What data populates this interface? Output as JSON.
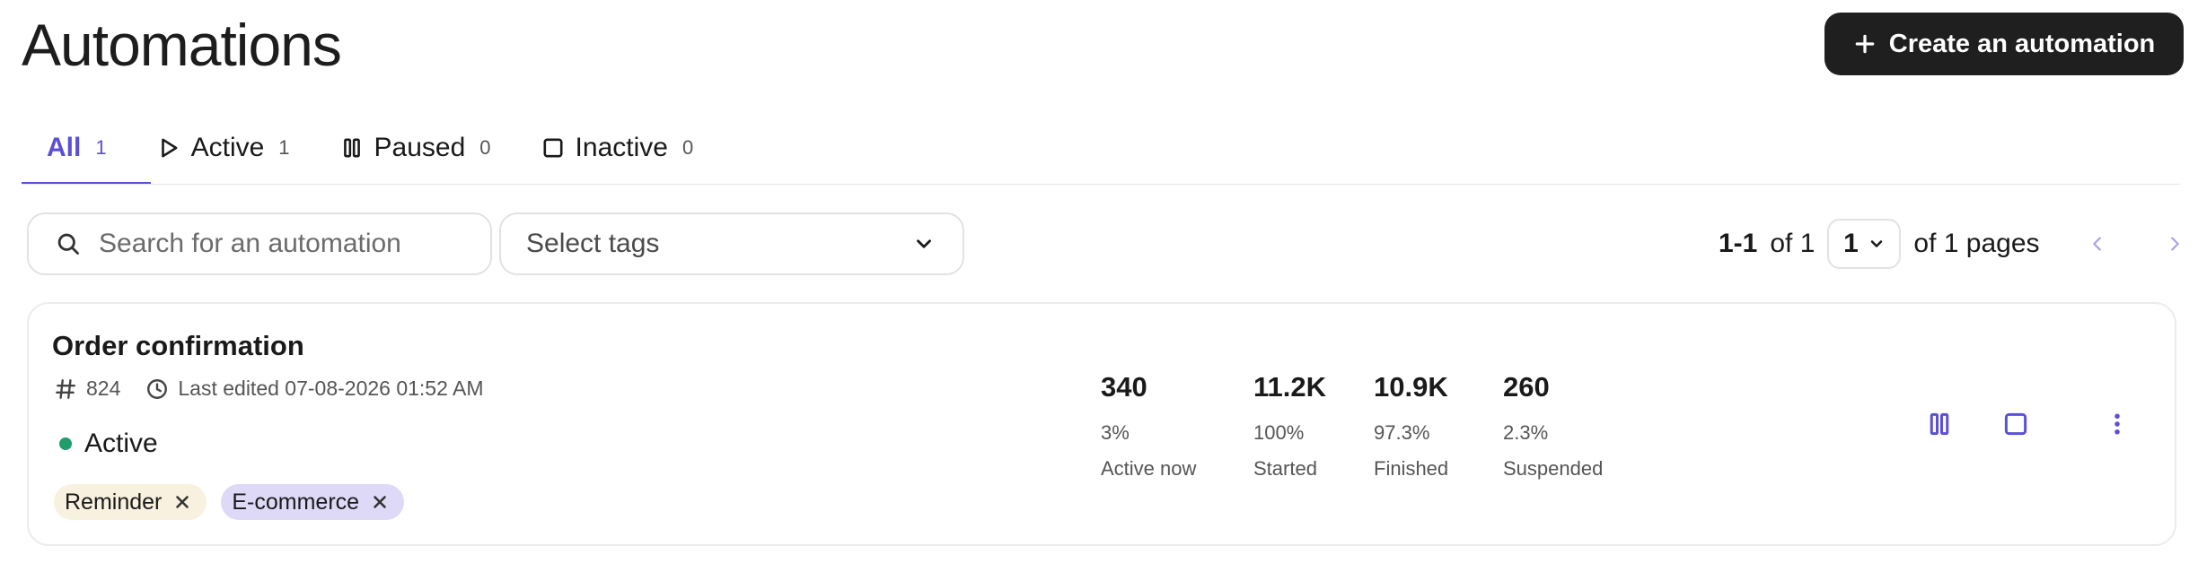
{
  "header": {
    "title": "Automations",
    "create_label": "Create an automation"
  },
  "tabs": [
    {
      "label": "All",
      "count": "1"
    },
    {
      "label": "Active",
      "count": "1"
    },
    {
      "label": "Paused",
      "count": "0"
    },
    {
      "label": "Inactive",
      "count": "0"
    }
  ],
  "filters": {
    "search_placeholder": "Search for an automation",
    "tags_placeholder": "Select tags"
  },
  "pagination": {
    "range": "1-1",
    "of_total": "of 1",
    "current_page": "1",
    "pages_text": "of 1 pages"
  },
  "automation": {
    "name": "Order confirmation",
    "id": "824",
    "last_edited": "Last edited 07-08-2026 01:52 AM",
    "status": "Active",
    "tags": [
      "Reminder",
      "E-commerce"
    ],
    "stats": [
      {
        "value": "340",
        "percent": "3%",
        "label": "Active now"
      },
      {
        "value": "11.2K",
        "percent": "100%",
        "label": "Started"
      },
      {
        "value": "10.9K",
        "percent": "97.3%",
        "label": "Finished"
      },
      {
        "value": "260",
        "percent": "2.3%",
        "label": "Suspended"
      }
    ]
  },
  "colors": {
    "accent": "#5b4fd6",
    "active_dot": "#1f9d6b",
    "reminder_chip": "#f8f1df",
    "ecommerce_chip": "#ddd9f7"
  },
  "icons": {
    "create": "plus-icon",
    "active": "play-icon",
    "paused": "pause-icon",
    "inactive": "stop-icon",
    "search": "search-icon",
    "tags": "chevron-down-icon",
    "id": "hash-icon",
    "edited": "clock-icon",
    "remove_tag": "close-icon",
    "more": "more-vertical-icon"
  }
}
